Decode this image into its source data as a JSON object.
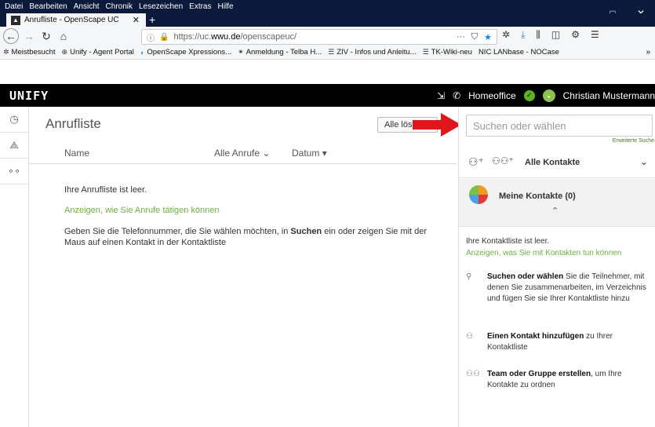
{
  "browser": {
    "menu": [
      "Datei",
      "Bearbeiten",
      "Ansicht",
      "Chronik",
      "Lesezeichen",
      "Extras",
      "Hilfe"
    ],
    "window_controls": {
      "minimize": "–",
      "maximize": "□",
      "close": "✕"
    },
    "tab_title": "Anrufliste - OpenScape UC",
    "tab_close": "✕",
    "new_tab": "+",
    "url": {
      "prefix": "https://uc.",
      "domain": "wwu.de",
      "path": "/openscapeuc/"
    },
    "bookmarks": [
      {
        "icon": "gear-icon",
        "label": "Meistbesucht"
      },
      {
        "icon": "globe-icon",
        "label": "Unify - Agent Portal"
      },
      {
        "icon": "app-icon",
        "label": "OpenScape Xpressions..."
      },
      {
        "icon": "star-icon",
        "label": "Anmeldung - Telba H..."
      },
      {
        "icon": "list-icon",
        "label": "ZIV - Infos und Anleitu..."
      },
      {
        "icon": "list-icon",
        "label": "TK-Wiki-neu"
      },
      {
        "icon": "nic-icon",
        "label": "NIC LANbase - NOCase"
      }
    ],
    "bookmarks_more": "»"
  },
  "header": {
    "logo": "unify",
    "status": "Homeoffice",
    "user": "Christian Mustermann"
  },
  "main": {
    "title": "Anrufliste",
    "clear_button": "Alle löschen",
    "columns": {
      "name": "Name",
      "filter": "Alle Anrufe",
      "date": "Datum"
    },
    "empty_text": "Ihre Anrufliste ist leer.",
    "help_link": "Anzeigen, wie Sie Anrufe tätigen können",
    "instructions_pre": "Geben Sie die Telefonnummer, die Sie wählen möchten, in ",
    "instructions_bold": "Suchen",
    "instructions_post": " ein oder zeigen Sie mit der Maus auf einen Kontakt in der Kontaktliste"
  },
  "contacts": {
    "search_placeholder": "Suchen oder wählen",
    "advanced_search": "Erweiterte Suche",
    "filter_label": "Alle Kontakte",
    "my_contacts": "Meine Kontakte (0)",
    "empty_text": "Ihre Kontaktliste ist leer.",
    "help_link": "Anzeigen, was Sie mit Kontakten tun können",
    "tips": [
      {
        "bold": "Suchen oder wählen",
        "text": " Sie die Teilnehmer, mit denen Sie zusammenarbeiten, im Verzeichnis und fügen Sie sie Ihrer Kontaktliste hinzu"
      },
      {
        "bold": "Einen Kontakt hinzufügen",
        "text": " zu Ihrer Kontaktliste"
      },
      {
        "bold": "Team oder Gruppe erstellen",
        "text": ", um Ihre Kontakte zu ordnen"
      }
    ]
  },
  "colors": {
    "accent_green": "#6cb33f",
    "header_bg": "#000000",
    "arrow_red": "#e0161b"
  }
}
